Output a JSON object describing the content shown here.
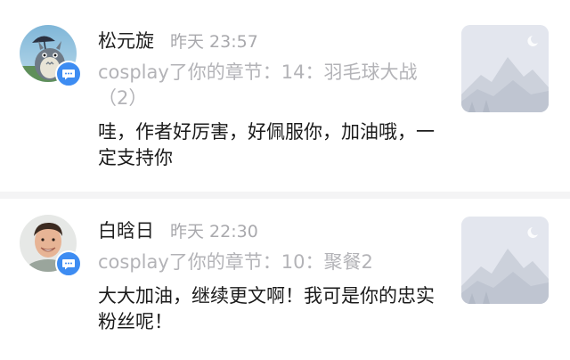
{
  "comments": [
    {
      "username": "松元旋",
      "time": "昨天 23:57",
      "action": "cosplay了你的章节：14：羽毛球大战（2）",
      "comment": "哇，作者好厉害，好佩服你，加油哦，一定支持你",
      "avatar_icon": "totoro-avatar-icon",
      "badge_icon": "chat-bubble-icon",
      "thumb_icon": "mountain-placeholder-icon"
    },
    {
      "username": "白晗日",
      "time": "昨天 22:30",
      "action": "cosplay了你的章节：10：聚餐2",
      "comment": "大大加油，继续更文啊！我可是你的忠实粉丝呢！",
      "avatar_icon": "smiling-man-avatar-icon",
      "badge_icon": "chat-bubble-icon",
      "thumb_icon": "mountain-placeholder-icon"
    }
  ],
  "colors": {
    "badge": "#3d8cf2",
    "username": "#222222",
    "time": "#a9a9ad",
    "action": "#b3b3b7",
    "comment": "#1b1b1b",
    "divider": "#f4f4f5"
  }
}
